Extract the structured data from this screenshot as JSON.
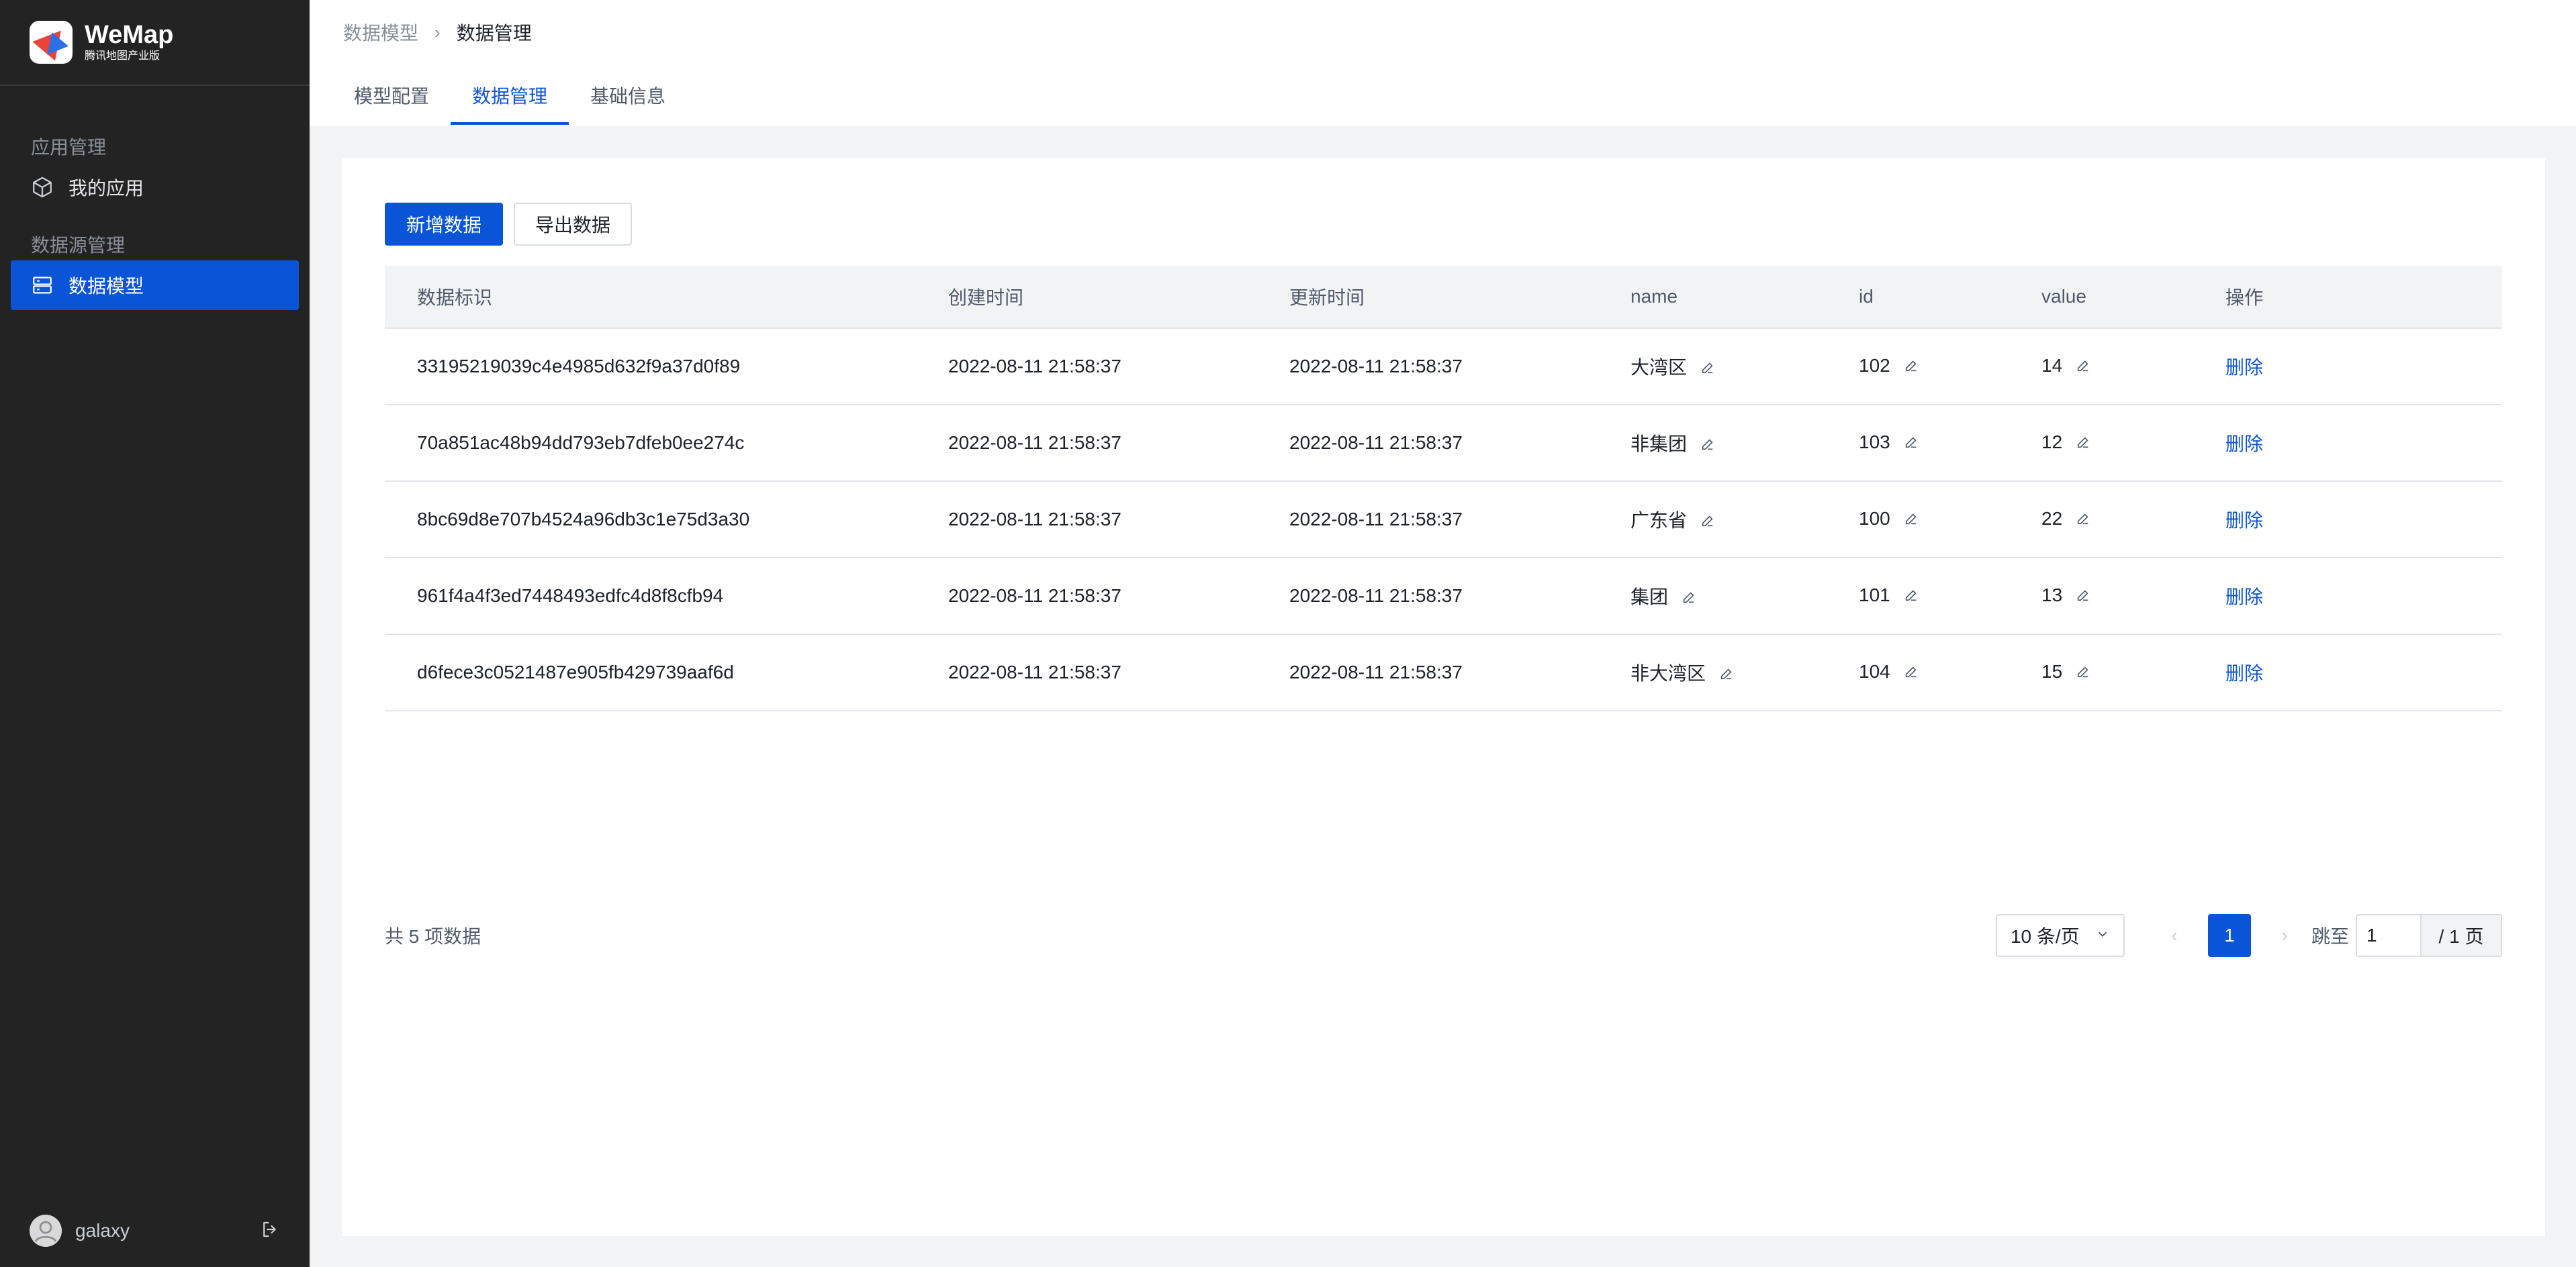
{
  "app": {
    "title": "WeMap",
    "subtitle": "腾讯地图产业版"
  },
  "sidebar": {
    "groups": [
      {
        "title": "应用管理",
        "items": [
          {
            "label": "我的应用",
            "icon": "cube-icon"
          }
        ]
      },
      {
        "title": "数据源管理",
        "items": [
          {
            "label": "数据模型",
            "icon": "database-icon",
            "active": true
          }
        ]
      }
    ],
    "user": {
      "name": "galaxy"
    }
  },
  "breadcrumb": {
    "parent": "数据模型",
    "current": "数据管理"
  },
  "tabs": [
    {
      "label": "模型配置"
    },
    {
      "label": "数据管理",
      "active": true
    },
    {
      "label": "基础信息"
    }
  ],
  "actions": {
    "add": "新增数据",
    "export": "导出数据"
  },
  "table": {
    "columns": [
      "数据标识",
      "创建时间",
      "更新时间",
      "name",
      "id",
      "value",
      "操作"
    ],
    "rows": [
      {
        "key": "33195219039c4e4985d632f9a37d0f89",
        "created": "2022-08-11 21:58:37",
        "updated": "2022-08-11 21:58:37",
        "name": "大湾区",
        "id": "102",
        "value": "14",
        "action": "删除"
      },
      {
        "key": "70a851ac48b94dd793eb7dfeb0ee274c",
        "created": "2022-08-11 21:58:37",
        "updated": "2022-08-11 21:58:37",
        "name": "非集团",
        "id": "103",
        "value": "12",
        "action": "删除"
      },
      {
        "key": "8bc69d8e707b4524a96db3c1e75d3a30",
        "created": "2022-08-11 21:58:37",
        "updated": "2022-08-11 21:58:37",
        "name": "广东省",
        "id": "100",
        "value": "22",
        "action": "删除"
      },
      {
        "key": "961f4a4f3ed7448493edfc4d8f8cfb94",
        "created": "2022-08-11 21:58:37",
        "updated": "2022-08-11 21:58:37",
        "name": "集团",
        "id": "101",
        "value": "13",
        "action": "删除"
      },
      {
        "key": "d6fece3c0521487e905fb429739aaf6d",
        "created": "2022-08-11 21:58:37",
        "updated": "2022-08-11 21:58:37",
        "name": "非大湾区",
        "id": "104",
        "value": "15",
        "action": "删除"
      }
    ]
  },
  "pagination": {
    "total_text": "共 5 项数据",
    "page_size": "10 条/页",
    "current_page": "1",
    "jump_label": "跳至",
    "jump_value": "1",
    "total_pages": "/ 1 页"
  },
  "colors": {
    "primary": "#0a55d7",
    "sidebar_bg": "#232323"
  }
}
